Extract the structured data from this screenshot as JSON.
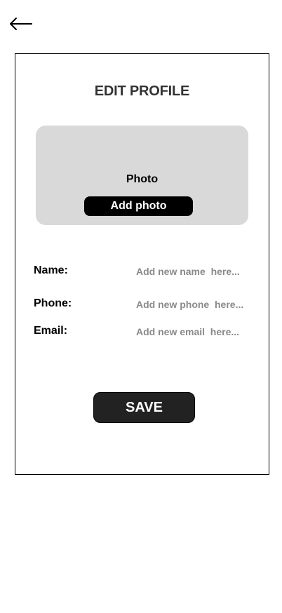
{
  "header": {
    "back_icon": "arrow-left-icon"
  },
  "card": {
    "title": "EDIT PROFILE",
    "photo": {
      "label": "Photo",
      "add_button_label": "Add photo"
    },
    "fields": {
      "name": {
        "label": "Name:",
        "placeholder": "Add new name  here..."
      },
      "phone": {
        "label": "Phone:",
        "placeholder": "Add new phone  here..."
      },
      "email": {
        "label": "Email:",
        "placeholder": "Add new email  here..."
      }
    },
    "save_label": "SAVE"
  },
  "colors": {
    "photo_box_bg": "#d9d9d9",
    "button_bg": "#000000",
    "save_bg": "#222222",
    "placeholder_text": "#8a8a8a",
    "title_text": "#333333"
  }
}
